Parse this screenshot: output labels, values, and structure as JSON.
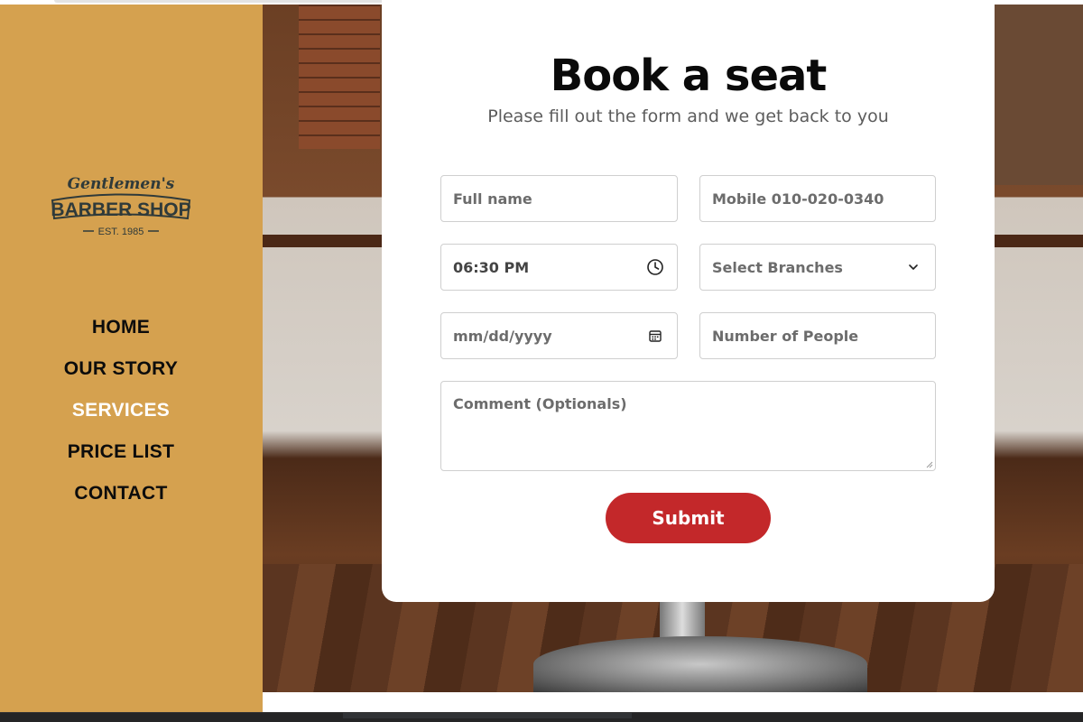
{
  "sidebar": {
    "logo": {
      "script": "Gentlemen's",
      "name": "BARBER SHOP",
      "est": "EST. 1985"
    },
    "nav": [
      {
        "label": "HOME"
      },
      {
        "label": "OUR STORY"
      },
      {
        "label": "SERVICES",
        "active": true
      },
      {
        "label": "PRICE LIST"
      },
      {
        "label": "CONTACT"
      }
    ]
  },
  "form": {
    "title": "Book a seat",
    "subtitle": "Please fill out the form and we get back to you",
    "full_name_placeholder": "Full name",
    "mobile_placeholder": "Mobile 010-020-0340",
    "time_value": "06:30 PM",
    "branch_label": "Select Branches",
    "date_placeholder": "mm/dd/yyyy",
    "people_placeholder": "Number of People",
    "comment_placeholder": "Comment (Optionals)",
    "submit_label": "Submit"
  },
  "colors": {
    "sidebar": "#d5a14f",
    "accent": "#c3282a",
    "active_nav": "#ffffff"
  },
  "icons": [
    "clock-icon",
    "chevron-down-icon",
    "calendar-icon"
  ]
}
